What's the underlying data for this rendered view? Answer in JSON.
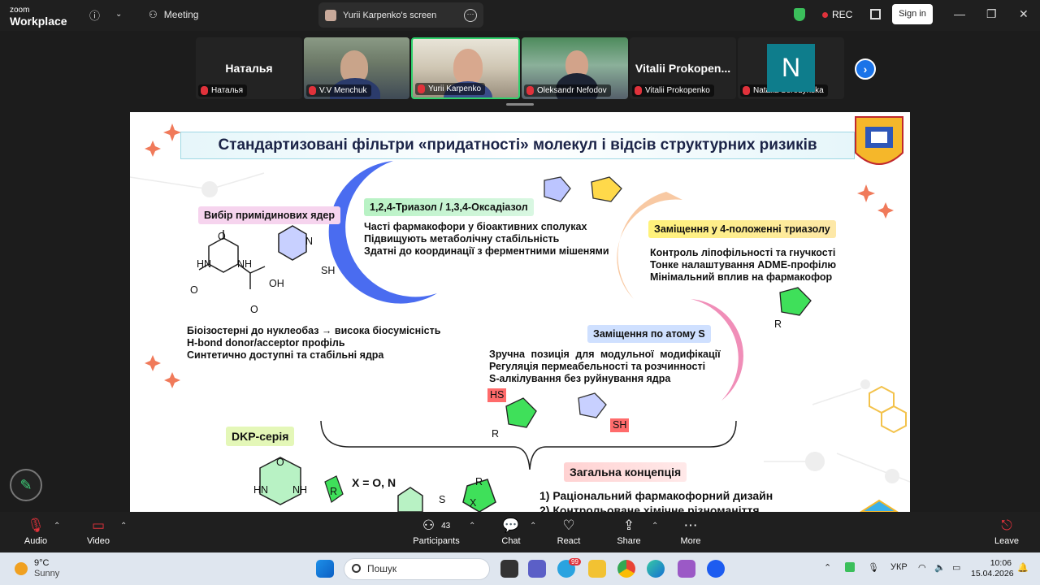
{
  "app": {
    "logo_line1": "zoom",
    "logo_line2": "Workplace",
    "meeting_label": "Meeting",
    "share_title": "Yurii Karpenko's screen",
    "rec_label": "REC",
    "signin_label": "Sign in"
  },
  "participants": [
    {
      "big_name": "Наталья",
      "tag": "Наталья"
    },
    {
      "tag": "V.V Menchuk"
    },
    {
      "tag": "Yurii Karpenko"
    },
    {
      "tag": "Oleksandr Nefodov"
    },
    {
      "big_name": "Vitalii Prokopen...",
      "tag": "Vitalii Prokopenko"
    },
    {
      "avatar_letter": "N",
      "tag": "Natalia Seredynska"
    }
  ],
  "slide": {
    "title": "Стандартизовані фільтри «придатності» молекул і відсів структурних ризиків",
    "sec1_heading": "Вибір примідинових ядер",
    "sec1_lines": [
      "Біоізостерні до нуклеобаз → висока біосумісність",
      "H-bond donor/acceptor профіль",
      "Синтетично доступні та стабільні ядра"
    ],
    "sec2_heading": "1,2,4-Триазол / 1,3,4-Оксадіазол",
    "sec2_lines": [
      "Часті фармакофори у біоактивних сполуках",
      "Підвищують метаболічну стабільність",
      "Здатні до координації з ферментними мішенями"
    ],
    "sec3_heading": "Заміщення у 4-положенні триазолу",
    "sec3_lines": [
      "Контроль ліпофільності та гнучкості",
      "Тонке налаштування ADME-профілю",
      "Мінімальний вплив на фармакофор"
    ],
    "sec4_heading": "Заміщення по атому S",
    "sec4_lines": [
      "Зручна позиція для модульної модифікації",
      "Регуляція пермеабельності та розчинності",
      "S-алкілування без руйнування ядра"
    ],
    "dkp_label": "DKP-серія",
    "x_label": "X = O, N",
    "concept_heading": "Загальна концепція",
    "concept_lines": [
      "1) Раціональний фармакофорний дизайн",
      "2) Контрольоване хімічне різноманіття"
    ],
    "chem": {
      "o": "O",
      "hn": "HN",
      "nh": "NH",
      "oh": "OH",
      "n": "N",
      "sh": "SH",
      "hs": "HS",
      "r": "R",
      "s": "S",
      "x": "X"
    }
  },
  "toolbar": {
    "audio": "Audio",
    "video": "Video",
    "participants": "Participants",
    "participants_count": "43",
    "chat": "Chat",
    "react": "React",
    "share": "Share",
    "more": "More",
    "leave": "Leave"
  },
  "taskbar": {
    "temp": "9°C",
    "weather": "Sunny",
    "search_placeholder": "Пошук",
    "lang": "УКР",
    "time": "10:06",
    "date": "15.04.2026",
    "badge": "99"
  },
  "colors": {
    "accent_green": "#2fd06b",
    "rec_red": "#e0323b",
    "next_blue": "#1a73e8"
  }
}
